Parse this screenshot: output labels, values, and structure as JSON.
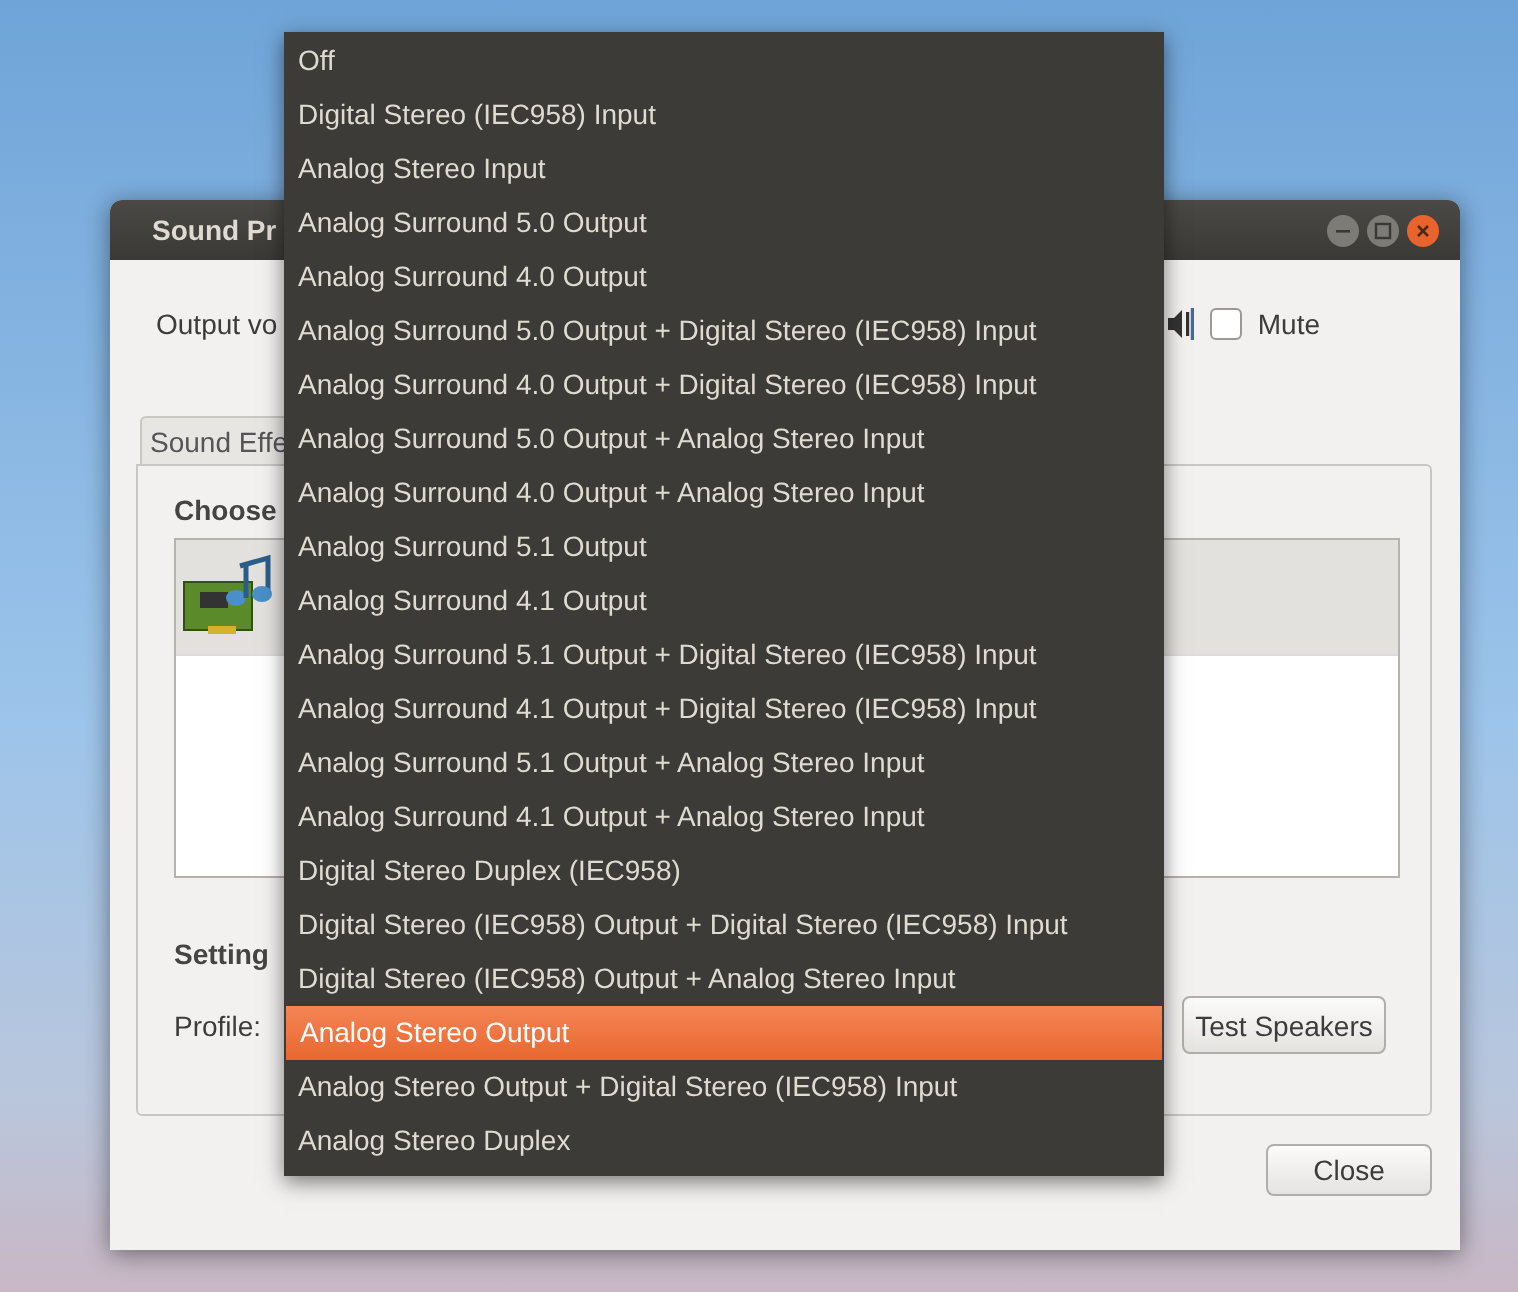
{
  "window": {
    "title": "Sound Pr"
  },
  "output_volume": {
    "label": "Output vo"
  },
  "mute": {
    "label": "Mute",
    "checked": false
  },
  "tabs": [
    {
      "label": "Sound Effe",
      "selected": false
    }
  ],
  "hardware": {
    "heading": "Choose",
    "devices": [
      {
        "selected": true
      }
    ]
  },
  "settings": {
    "heading": "Setting",
    "profile_label": "Profile:",
    "test_button": "Test Speakers"
  },
  "profile_menu": [
    {
      "label": "Off",
      "selected": false
    },
    {
      "label": "Digital Stereo (IEC958) Input",
      "selected": false
    },
    {
      "label": "Analog Stereo Input",
      "selected": false
    },
    {
      "label": "Analog Surround 5.0 Output",
      "selected": false
    },
    {
      "label": "Analog Surround 4.0 Output",
      "selected": false
    },
    {
      "label": "Analog Surround 5.0 Output + Digital Stereo (IEC958) Input",
      "selected": false
    },
    {
      "label": "Analog Surround 4.0 Output + Digital Stereo (IEC958) Input",
      "selected": false
    },
    {
      "label": "Analog Surround 5.0 Output + Analog Stereo Input",
      "selected": false
    },
    {
      "label": "Analog Surround 4.0 Output + Analog Stereo Input",
      "selected": false
    },
    {
      "label": "Analog Surround 5.1 Output",
      "selected": false
    },
    {
      "label": "Analog Surround 4.1 Output",
      "selected": false
    },
    {
      "label": "Analog Surround 5.1 Output + Digital Stereo (IEC958) Input",
      "selected": false
    },
    {
      "label": "Analog Surround 4.1 Output + Digital Stereo (IEC958) Input",
      "selected": false
    },
    {
      "label": "Analog Surround 5.1 Output + Analog Stereo Input",
      "selected": false
    },
    {
      "label": "Analog Surround 4.1 Output + Analog Stereo Input",
      "selected": false
    },
    {
      "label": "Digital Stereo Duplex (IEC958)",
      "selected": false
    },
    {
      "label": "Digital Stereo (IEC958) Output + Digital Stereo (IEC958) Input",
      "selected": false
    },
    {
      "label": "Digital Stereo (IEC958) Output + Analog Stereo Input",
      "selected": false
    },
    {
      "label": "Analog Stereo Output",
      "selected": true
    },
    {
      "label": "Analog Stereo Output + Digital Stereo (IEC958) Input",
      "selected": false
    },
    {
      "label": "Analog Stereo Duplex",
      "selected": false
    }
  ],
  "buttons": [
    "Close"
  ]
}
